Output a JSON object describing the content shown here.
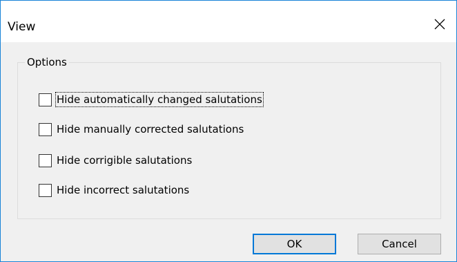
{
  "window": {
    "title": "View",
    "close_icon": "close-icon"
  },
  "options": {
    "group_label": "Options",
    "checkboxes": [
      {
        "label": "Hide automatically changed salutations",
        "checked": false,
        "focused": true
      },
      {
        "label": "Hide manually corrected salutations",
        "checked": false,
        "focused": false
      },
      {
        "label": "Hide corrigible salutations",
        "checked": false,
        "focused": false
      },
      {
        "label": "Hide incorrect salutations",
        "checked": false,
        "focused": false
      }
    ]
  },
  "buttons": {
    "ok_label": "OK",
    "cancel_label": "Cancel"
  },
  "colors": {
    "window_border": "#1883d7",
    "default_button_border": "#0078d7",
    "dialog_background": "#f0f0f0"
  }
}
